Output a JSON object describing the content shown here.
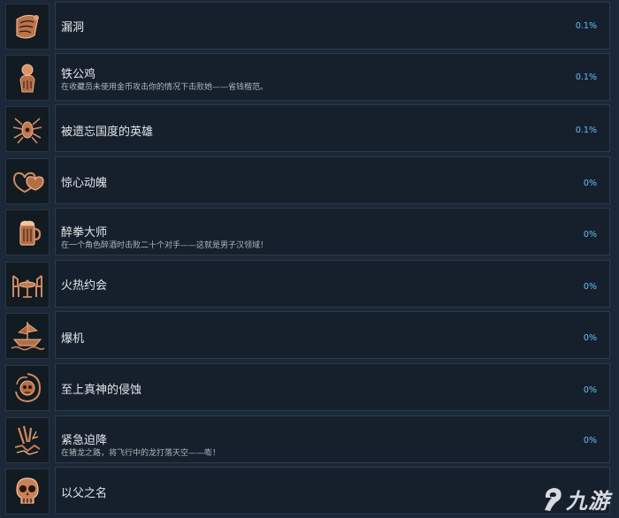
{
  "achievements": [
    {
      "icon": "scroll-icon",
      "title": "漏洞",
      "desc": "",
      "pct": "0.1%"
    },
    {
      "icon": "coin-hand-icon",
      "title": "铁公鸡",
      "desc": "在收藏员未使用金币攻击你的情况下击败她——省钱楷范。",
      "pct": "0.1%"
    },
    {
      "icon": "spider-emblem-icon",
      "title": "被遗忘国度的英雄",
      "desc": "",
      "pct": "0.1%"
    },
    {
      "icon": "hearts-icon",
      "title": "惊心动魄",
      "desc": "",
      "pct": "0%"
    },
    {
      "icon": "beer-mug-icon",
      "title": "醉拳大师",
      "desc": "在一个角色醉酒时击败二十个对手——这就是男子汉领域！",
      "pct": "0%"
    },
    {
      "icon": "dinner-table-icon",
      "title": "火热约会",
      "desc": "",
      "pct": "0%"
    },
    {
      "icon": "ship-icon",
      "title": "爆机",
      "desc": "",
      "pct": "0%"
    },
    {
      "icon": "skull-swirl-icon",
      "title": "至上真神的侵蚀",
      "desc": "",
      "pct": "0%"
    },
    {
      "icon": "claws-icon",
      "title": "紧急迫降",
      "desc": "在猪龙之路，将飞行中的龙打落天空——嘭！",
      "pct": "0%"
    },
    {
      "icon": "skull-icon",
      "title": "以父之名",
      "desc": "",
      "pct": ""
    }
  ],
  "watermark": {
    "text": "九游"
  },
  "colors": {
    "background": "#1b2838",
    "panel": "#16202d",
    "percent": "#66c0f4",
    "icon_bronze": "#c8825a"
  }
}
